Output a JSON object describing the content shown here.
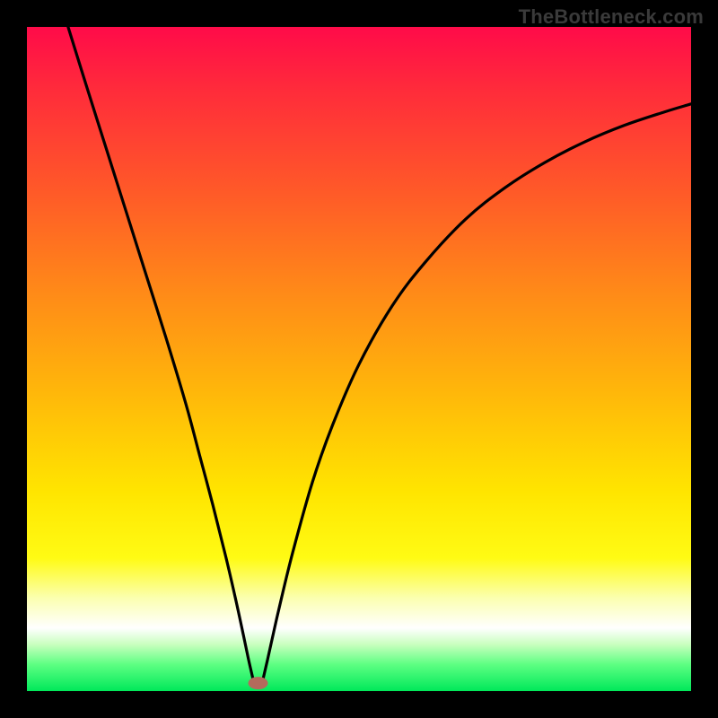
{
  "watermark": "TheBottleneck.com",
  "colors": {
    "frame": "#000000",
    "gradient_stops": [
      {
        "offset": 0.0,
        "color": "#ff0b49"
      },
      {
        "offset": 0.1,
        "color": "#ff2d3a"
      },
      {
        "offset": 0.25,
        "color": "#ff5a28"
      },
      {
        "offset": 0.4,
        "color": "#ff8a18"
      },
      {
        "offset": 0.55,
        "color": "#ffb70a"
      },
      {
        "offset": 0.7,
        "color": "#ffe500"
      },
      {
        "offset": 0.8,
        "color": "#fffb14"
      },
      {
        "offset": 0.86,
        "color": "#fbffb0"
      },
      {
        "offset": 0.905,
        "color": "#ffffff"
      },
      {
        "offset": 0.93,
        "color": "#c8ffbe"
      },
      {
        "offset": 0.96,
        "color": "#5dff82"
      },
      {
        "offset": 1.0,
        "color": "#00e85a"
      }
    ],
    "curve": "#000000",
    "marker": "#b46a5c"
  },
  "chart_data": {
    "type": "line",
    "title": "",
    "xlabel": "",
    "ylabel": "",
    "xlim": [
      0,
      100
    ],
    "ylim": [
      0,
      100
    ],
    "grid": false,
    "series": [
      {
        "name": "left-branch",
        "x": [
          6.2,
          9,
          12,
          15,
          18,
          21,
          24,
          26,
          28,
          30,
          31.5,
          32.6,
          33.4,
          34.0
        ],
        "y": [
          100,
          91,
          81.5,
          72,
          62.5,
          53,
          43,
          35.5,
          28,
          20,
          13.5,
          8.4,
          4.6,
          2.0
        ]
      },
      {
        "name": "right-branch",
        "x": [
          35.6,
          36.2,
          37.0,
          38,
          40,
          43,
          46,
          50,
          55,
          60,
          66,
          72,
          78,
          84,
          90,
          96,
          100
        ],
        "y": [
          2.0,
          4.6,
          8.2,
          12.6,
          20.8,
          31.5,
          40.0,
          49.2,
          58.0,
          64.6,
          71.0,
          75.8,
          79.6,
          82.7,
          85.2,
          87.2,
          88.4
        ]
      }
    ],
    "annotations": [
      {
        "name": "vertex-marker",
        "x": 34.8,
        "y": 1.2
      }
    ]
  }
}
